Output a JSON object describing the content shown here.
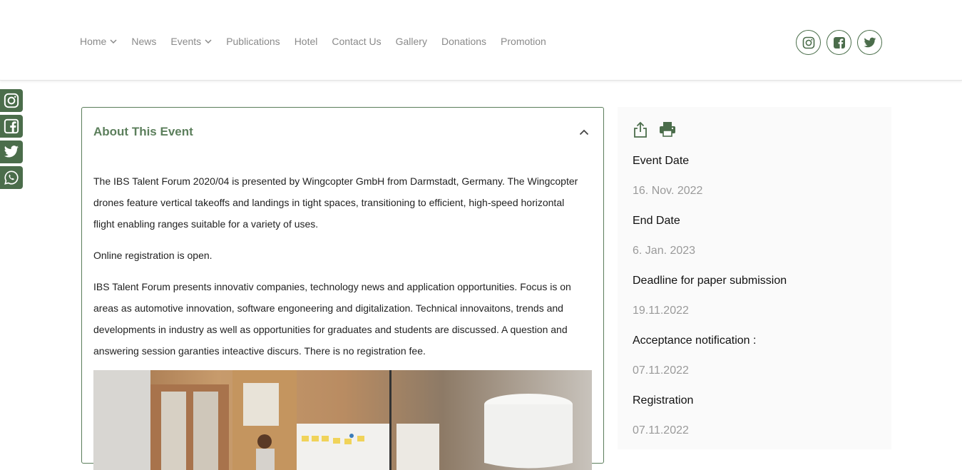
{
  "nav": {
    "items": [
      {
        "label": "Home",
        "has_dropdown": true
      },
      {
        "label": "News",
        "has_dropdown": false
      },
      {
        "label": "Events",
        "has_dropdown": true
      },
      {
        "label": "Publications",
        "has_dropdown": false
      },
      {
        "label": "Hotel",
        "has_dropdown": false
      },
      {
        "label": "Contact Us",
        "has_dropdown": false
      },
      {
        "label": "Gallery",
        "has_dropdown": false
      },
      {
        "label": "Donations",
        "has_dropdown": false
      },
      {
        "label": "Promotion",
        "has_dropdown": false
      }
    ]
  },
  "social": {
    "header_icons": [
      "instagram-icon",
      "facebook-icon",
      "twitter-icon"
    ],
    "side_icons": [
      "instagram-icon",
      "facebook-icon",
      "twitter-icon",
      "whatsapp-icon"
    ]
  },
  "about": {
    "title": "About This Event",
    "paragraphs": [
      "The IBS Talent Forum 2020/04 is presented by Wingcopter GmbH from Darmstadt, Germany. The Wingcopter drones feature vertical takeoffs and landings in tight spaces, transitioning to efficient, high-speed horizontal flight enabling ranges suitable for a variety of uses.",
      "Online registration is open.",
      "IBS Talent Forum presents innovativ companies, technology news and application opportunities. Focus is on areas as automotive innovation, software engoneering and digitalization. Technical innovaitons, trends and developments in industry as well as opportunities for graduates and students are discussed. A question and answering session garanties inteactive discurs. There is no registration fee."
    ]
  },
  "info": {
    "tools": [
      "share-icon",
      "print-icon"
    ],
    "fields": [
      {
        "label": "Event Date",
        "value": "16. Nov. 2022"
      },
      {
        "label": "End Date",
        "value": "6. Jan. 2023"
      },
      {
        "label": "Deadline for paper submission",
        "value": "19.11.2022"
      },
      {
        "label": "Acceptance notification :",
        "value": "07.11.2022"
      },
      {
        "label": "Registration",
        "value": "07.11.2022"
      }
    ]
  },
  "colors": {
    "accent": "#4b6d4b",
    "title_green": "#5c7f5c",
    "nav_text": "#8a8a8a",
    "muted_value": "#9a9a9a",
    "panel_bg": "#fafafa"
  }
}
